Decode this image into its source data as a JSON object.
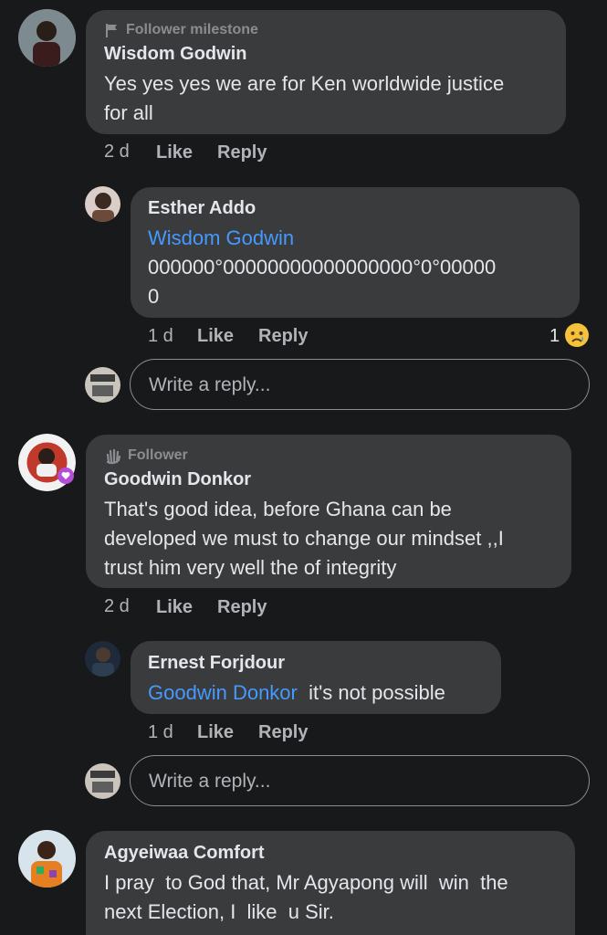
{
  "comments": [
    {
      "badge": "Follower milestone",
      "author": "Wisdom Godwin",
      "text_lines": [
        "Yes yes yes we are for Ken worldwide justice",
        "for all"
      ],
      "time": "2 d",
      "like": "Like",
      "reply": "Reply"
    },
    {
      "badge": "Follower",
      "author": "Goodwin Donkor",
      "text_lines": [
        "That's good idea, before Ghana can be",
        "developed we must to change our mindset ,,I",
        "trust him very well the of integrity"
      ],
      "time": "2 d",
      "like": "Like",
      "reply": "Reply"
    },
    {
      "author": "Agyeiwaa Comfort",
      "text_lines": [
        "I pray  to God that, Mr Agyapong will  win  the",
        "next Election, I  like  u Sir."
      ]
    }
  ],
  "replies": [
    {
      "author": "Esther Addo",
      "mention": "Wisdom Godwin",
      "text_lines": [
        "000000°00000000000000000°0°00000",
        "0"
      ],
      "time": "1 d",
      "like": "Like",
      "reply": "Reply",
      "reaction_count": "1",
      "reaction_icon": "sad-face"
    },
    {
      "author": "Ernest Forjdour",
      "mention": "Goodwin Donkor",
      "text": "it's not possible",
      "time": "1 d",
      "like": "Like",
      "reply": "Reply"
    }
  ],
  "reply_box": {
    "placeholder": "Write a reply..."
  },
  "colors": {
    "background": "#18191a",
    "bubble": "#3a3b3c",
    "link": "#4599ff",
    "meta": "#b0b3b8"
  }
}
